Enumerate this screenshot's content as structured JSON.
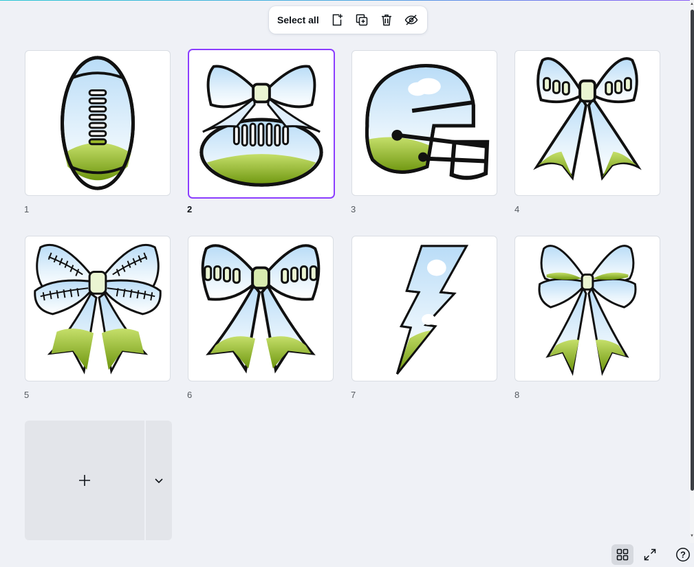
{
  "toolbar": {
    "select_all_label": "Select all",
    "icons": [
      "add-page-icon",
      "duplicate-page-icon",
      "trash-icon",
      "hide-eye-icon"
    ]
  },
  "pages": [
    {
      "number": "1",
      "subject": "football"
    },
    {
      "number": "2",
      "subject": "bow-with-football",
      "selected": true
    },
    {
      "number": "3",
      "subject": "football-helmet"
    },
    {
      "number": "4",
      "subject": "laced-bow"
    },
    {
      "number": "5",
      "subject": "stitched-bow"
    },
    {
      "number": "6",
      "subject": "laced-bow-2"
    },
    {
      "number": "7",
      "subject": "lightning-bolt"
    },
    {
      "number": "8",
      "subject": "sky-bow"
    }
  ],
  "add_page": {
    "icon": "plus-icon",
    "more_icon": "chevron-down-icon"
  },
  "bottom_bar": {
    "icons": [
      "grid-view-icon",
      "fullscreen-icon",
      "help-icon"
    ],
    "help_label": "?"
  },
  "colors": {
    "accent": "#8b3dff",
    "sky": "#cfe8fb",
    "grass": "#7aa11a",
    "background": "#eff1f6"
  }
}
